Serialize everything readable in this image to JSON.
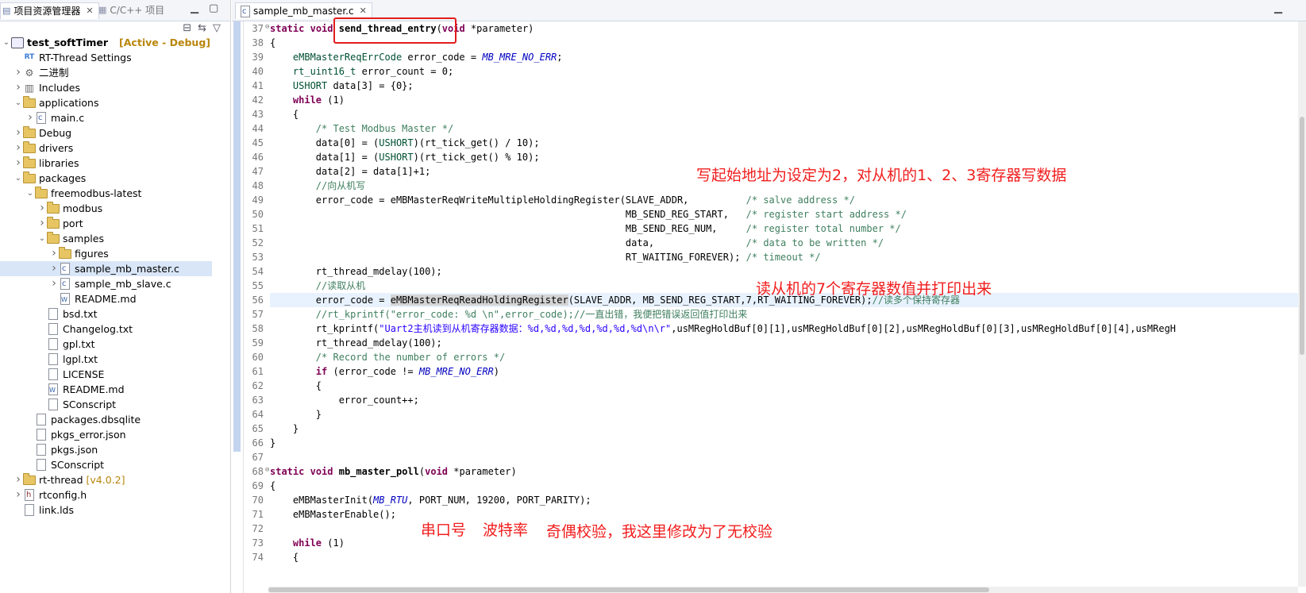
{
  "left_panel": {
    "tab_active": "项目资源管理器",
    "tab_inactive": "C/C++ 项目",
    "tree": [
      {
        "label": "test_softTimer",
        "extra": "[Active - Debug]",
        "icon": "project",
        "level": 0,
        "expanded": "open"
      },
      {
        "label": "RT-Thread Settings",
        "icon": "rt",
        "level": 1,
        "expanded": "none"
      },
      {
        "label": "二进制",
        "icon": "binaries",
        "level": 1,
        "expanded": "closed"
      },
      {
        "label": "Includes",
        "icon": "includes",
        "level": 1,
        "expanded": "closed"
      },
      {
        "label": "applications",
        "icon": "folder",
        "level": 1,
        "expanded": "open"
      },
      {
        "label": "main.c",
        "icon": "file-c",
        "level": 2,
        "expanded": "closed"
      },
      {
        "label": "Debug",
        "icon": "folder",
        "level": 1,
        "expanded": "closed"
      },
      {
        "label": "drivers",
        "icon": "folder",
        "level": 1,
        "expanded": "closed"
      },
      {
        "label": "libraries",
        "icon": "folder",
        "level": 1,
        "expanded": "closed"
      },
      {
        "label": "packages",
        "icon": "folder",
        "level": 1,
        "expanded": "open"
      },
      {
        "label": "freemodbus-latest",
        "icon": "folder",
        "level": 2,
        "expanded": "open"
      },
      {
        "label": "modbus",
        "icon": "folder",
        "level": 3,
        "expanded": "closed"
      },
      {
        "label": "port",
        "icon": "folder",
        "level": 3,
        "expanded": "closed"
      },
      {
        "label": "samples",
        "icon": "folder",
        "level": 3,
        "expanded": "open"
      },
      {
        "label": "figures",
        "icon": "folder",
        "level": 4,
        "expanded": "closed"
      },
      {
        "label": "sample_mb_master.c",
        "icon": "file-c",
        "level": 4,
        "expanded": "closed",
        "selected": "yes"
      },
      {
        "label": "sample_mb_slave.c",
        "icon": "file-c",
        "level": 4,
        "expanded": "closed"
      },
      {
        "label": "README.md",
        "icon": "file-w",
        "level": 4,
        "expanded": "none"
      },
      {
        "label": "bsd.txt",
        "icon": "file",
        "level": 3,
        "expanded": "none"
      },
      {
        "label": "Changelog.txt",
        "icon": "file",
        "level": 3,
        "expanded": "none"
      },
      {
        "label": "gpl.txt",
        "icon": "file",
        "level": 3,
        "expanded": "none"
      },
      {
        "label": "lgpl.txt",
        "icon": "file",
        "level": 3,
        "expanded": "none"
      },
      {
        "label": "LICENSE",
        "icon": "file",
        "level": 3,
        "expanded": "none"
      },
      {
        "label": "README.md",
        "icon": "file-w",
        "level": 3,
        "expanded": "none"
      },
      {
        "label": "SConscript",
        "icon": "file",
        "level": 3,
        "expanded": "none"
      },
      {
        "label": "packages.dbsqlite",
        "icon": "file",
        "level": 2,
        "expanded": "none"
      },
      {
        "label": "pkgs_error.json",
        "icon": "file-json",
        "level": 2,
        "expanded": "none"
      },
      {
        "label": "pkgs.json",
        "icon": "file-json",
        "level": 2,
        "expanded": "none"
      },
      {
        "label": "SConscript",
        "icon": "file",
        "level": 2,
        "expanded": "none"
      },
      {
        "label": "rt-thread",
        "extra": "[v4.0.2]",
        "icon": "folder",
        "level": 1,
        "expanded": "closed"
      },
      {
        "label": "rtconfig.h",
        "icon": "file-h",
        "level": 1,
        "expanded": "closed"
      },
      {
        "label": "link.lds",
        "icon": "file-lds",
        "level": 1,
        "expanded": "none"
      }
    ]
  },
  "editor": {
    "tab_label": "sample_mb_master.c",
    "lines": [
      {
        "n": "37",
        "fold": "⊖",
        "html": "<span class=\"kw\">static</span> <span class=\"kw\">void</span> <span class=\"fn\">send_thread_entry</span>(<span class=\"kw\">void</span> *parameter)"
      },
      {
        "n": "38",
        "html": "{"
      },
      {
        "n": "39",
        "html": "    <span class=\"ty\">eMBMasterReqErrCode</span> error_code = <span class=\"cn\">MB_MRE_NO_ERR</span>;"
      },
      {
        "n": "40",
        "html": "    <span class=\"ty\">rt_uint16_t</span> error_count = 0;"
      },
      {
        "n": "41",
        "html": "    <span class=\"ty\">USHORT</span> data[3] = {0};"
      },
      {
        "n": "42",
        "html": "    <span class=\"kw\">while</span> (1)"
      },
      {
        "n": "43",
        "html": "    {"
      },
      {
        "n": "44",
        "html": "        <span class=\"cm\">/* Test Modbus Master */</span>"
      },
      {
        "n": "45",
        "html": "        data[0] = (<span class=\"ty\">USHORT</span>)(rt_tick_get() / 10);"
      },
      {
        "n": "46",
        "html": "        data[1] = (<span class=\"ty\">USHORT</span>)(rt_tick_get() % 10);"
      },
      {
        "n": "47",
        "html": "        data[2] = data[1]+1;"
      },
      {
        "n": "48",
        "html": "        <span class=\"cm\">//向从机写</span>"
      },
      {
        "n": "49",
        "html": "        error_code = eMBMasterReqWriteMultipleHoldingRegister(SLAVE_ADDR,          <span class=\"cm\">/* salve address */</span>"
      },
      {
        "n": "50",
        "html": "                                                              MB_SEND_REG_START,   <span class=\"cm\">/* register start address */</span>"
      },
      {
        "n": "51",
        "html": "                                                              MB_SEND_REG_NUM,     <span class=\"cm\">/* register total number */</span>"
      },
      {
        "n": "52",
        "html": "                                                              data,                <span class=\"cm\">/* data to be written */</span>"
      },
      {
        "n": "53",
        "html": "                                                              RT_WAITING_FOREVER); <span class=\"cm\">/* timeout */</span>"
      },
      {
        "n": "54",
        "html": "        rt_thread_mdelay(100);"
      },
      {
        "n": "55",
        "html": "        <span class=\"cm\">//读取从机</span>"
      },
      {
        "n": "56",
        "html": "        error_code = <span class=\"occ\">eMBMasterReqReadHoldingRegister</span>(SLAVE_ADDR, MB_SEND_REG_START,7,RT_WAITING_FOREVER);<span class=\"cm\">//读多个保持寄存器</span>",
        "highlight": "yes"
      },
      {
        "n": "57",
        "html": "        <span class=\"cm\">//rt_kprintf(\"error_code: %d \\n\",error_code);//一直出错，我便把错误返回值打印出来</span>"
      },
      {
        "n": "58",
        "html": "        rt_kprintf(<span class=\"st\">\"Uart2主机读到从机寄存器数据：%d,%d,%d,%d,%d,%d,%d\\n\\r\"</span>,usMRegHoldBuf[0][1],usMRegHoldBuf[0][2],usMRegHoldBuf[0][3],usMRegHoldBuf[0][4],usMRegH"
      },
      {
        "n": "59",
        "html": "        rt_thread_mdelay(100);"
      },
      {
        "n": "60",
        "html": "        <span class=\"cm\">/* Record the number of errors */</span>"
      },
      {
        "n": "61",
        "html": "        <span class=\"kw\">if</span> (error_code != <span class=\"cn\">MB_MRE_NO_ERR</span>)"
      },
      {
        "n": "62",
        "html": "        {"
      },
      {
        "n": "63",
        "html": "            error_count++;"
      },
      {
        "n": "64",
        "html": "        }"
      },
      {
        "n": "65",
        "html": "    }"
      },
      {
        "n": "66",
        "html": "}"
      },
      {
        "n": "67",
        "html": ""
      },
      {
        "n": "68",
        "fold": "⊖",
        "html": "<span class=\"kw\">static</span> <span class=\"kw\">void</span> <span class=\"fn\">mb_master_poll</span>(<span class=\"kw\">void</span> *parameter)"
      },
      {
        "n": "69",
        "html": "{"
      },
      {
        "n": "70",
        "html": "    eMBMasterInit(<span class=\"cn\">MB_RTU</span>, PORT_NUM, 19200, PORT_PARITY);"
      },
      {
        "n": "71",
        "html": "    eMBMasterEnable();"
      },
      {
        "n": "72",
        "html": ""
      },
      {
        "n": "73",
        "html": "    <span class=\"kw\">while</span> (1)"
      },
      {
        "n": "74",
        "html": "    {"
      }
    ]
  },
  "annotations": {
    "write_note": "写起始地址为设定为2，对从机的1、2、3寄存器写数据",
    "read_note": "读从机的7个寄存器数值并打印出来",
    "port_note": "串口号",
    "baud_note": "波特率",
    "parity_note": "奇偶校验，我这里修改为了无校验"
  },
  "colors": {
    "keyword": "#7f0055",
    "comment": "#3f7f5f",
    "string": "#2a00ff",
    "annotation": "#f21d1d",
    "highlight_line": "#e8f2fe"
  }
}
